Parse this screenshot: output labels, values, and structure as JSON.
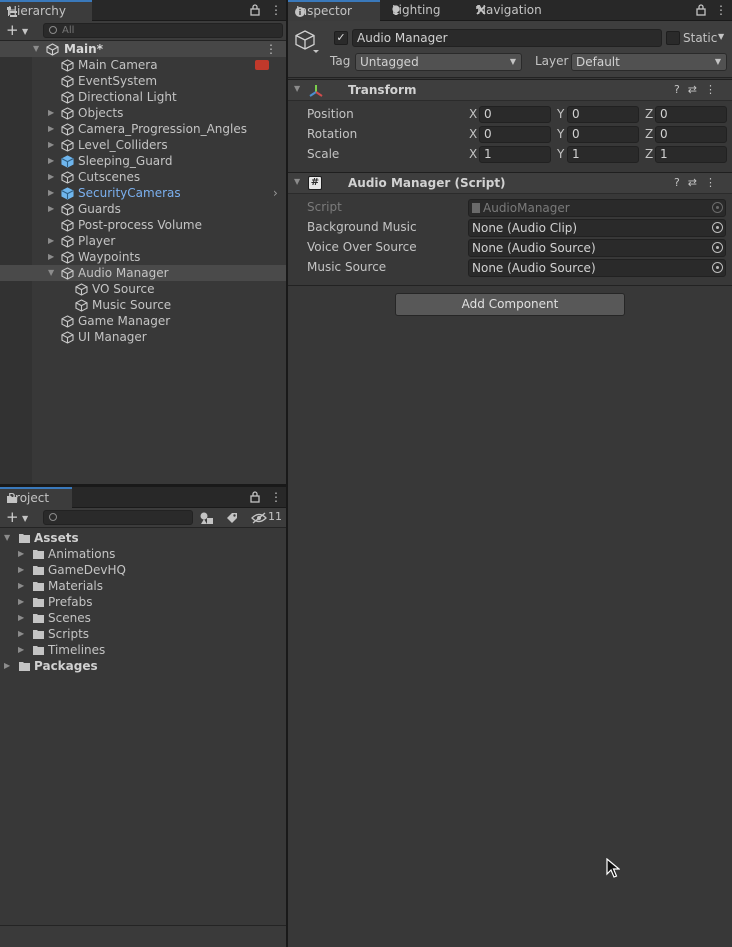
{
  "hierarchy": {
    "tab_label": "Hierarchy",
    "search_placeholder": "All",
    "scene_name": "Main*",
    "items": [
      {
        "label": "Main Camera",
        "indent": 1,
        "expandable": false,
        "prefab": false
      },
      {
        "label": "EventSystem",
        "indent": 1,
        "expandable": false,
        "prefab": false
      },
      {
        "label": "Directional Light",
        "indent": 1,
        "expandable": false,
        "prefab": false
      },
      {
        "label": "Objects",
        "indent": 1,
        "expandable": true,
        "expanded": false,
        "prefab": false
      },
      {
        "label": "Camera_Progression_Angles",
        "indent": 1,
        "expandable": true,
        "expanded": false,
        "prefab": false
      },
      {
        "label": "Level_Colliders",
        "indent": 1,
        "expandable": true,
        "expanded": false,
        "prefab": false
      },
      {
        "label": "Sleeping_Guard",
        "indent": 1,
        "expandable": true,
        "expanded": false,
        "prefab": true,
        "label_prefab_color": false
      },
      {
        "label": "Cutscenes",
        "indent": 1,
        "expandable": true,
        "expanded": false,
        "prefab": false
      },
      {
        "label": "SecurityCameras",
        "indent": 1,
        "expandable": true,
        "expanded": false,
        "prefab": true,
        "label_prefab_color": true
      },
      {
        "label": "Guards",
        "indent": 1,
        "expandable": true,
        "expanded": false,
        "prefab": false
      },
      {
        "label": "Post-process Volume",
        "indent": 1,
        "expandable": false,
        "prefab": false
      },
      {
        "label": "Player",
        "indent": 1,
        "expandable": true,
        "expanded": false,
        "prefab": false
      },
      {
        "label": "Waypoints",
        "indent": 1,
        "expandable": true,
        "expanded": false,
        "prefab": false
      },
      {
        "label": "Audio Manager",
        "indent": 1,
        "expandable": true,
        "expanded": true,
        "prefab": false,
        "selected": true
      },
      {
        "label": "VO Source",
        "indent": 2,
        "expandable": false,
        "prefab": false
      },
      {
        "label": "Music Source",
        "indent": 2,
        "expandable": false,
        "prefab": false
      },
      {
        "label": "Game Manager",
        "indent": 1,
        "expandable": false,
        "prefab": false
      },
      {
        "label": "UI Manager",
        "indent": 1,
        "expandable": false,
        "prefab": false
      }
    ]
  },
  "project": {
    "tab_label": "Project",
    "hidden_count": "11",
    "items": [
      {
        "label": "Assets",
        "indent": 0,
        "expanded": true,
        "bold": true
      },
      {
        "label": "Animations",
        "indent": 1,
        "expanded": false,
        "bold": false
      },
      {
        "label": "GameDevHQ",
        "indent": 1,
        "expanded": false,
        "bold": false
      },
      {
        "label": "Materials",
        "indent": 1,
        "expanded": false,
        "bold": false
      },
      {
        "label": "Prefabs",
        "indent": 1,
        "expanded": false,
        "bold": false
      },
      {
        "label": "Scenes",
        "indent": 1,
        "expanded": false,
        "bold": false
      },
      {
        "label": "Scripts",
        "indent": 1,
        "expanded": false,
        "bold": false
      },
      {
        "label": "Timelines",
        "indent": 1,
        "expanded": false,
        "bold": false
      },
      {
        "label": "Packages",
        "indent": 0,
        "expanded": false,
        "bold": true
      }
    ]
  },
  "inspector": {
    "tabs": [
      {
        "label": "Inspector",
        "icon": "info-icon"
      },
      {
        "label": "Lighting",
        "icon": "bulb-icon"
      },
      {
        "label": "Navigation",
        "icon": "compass-icon"
      }
    ],
    "object_name": "Audio Manager",
    "static_label": "Static",
    "tag_label": "Tag",
    "tag_value": "Untagged",
    "layer_label": "Layer",
    "layer_value": "Default",
    "transform": {
      "title": "Transform",
      "rows": [
        {
          "label": "Position",
          "x": "0",
          "y": "0",
          "z": "0"
        },
        {
          "label": "Rotation",
          "x": "0",
          "y": "0",
          "z": "0"
        },
        {
          "label": "Scale",
          "x": "1",
          "y": "1",
          "z": "1"
        }
      ]
    },
    "script_component": {
      "title": "Audio Manager (Script)",
      "rows": [
        {
          "label": "Script",
          "value": "AudioManager",
          "disabled": true
        },
        {
          "label": "Background Music",
          "value": "None (Audio Clip)",
          "disabled": false
        },
        {
          "label": "Voice Over Source",
          "value": "None (Audio Source)",
          "disabled": false
        },
        {
          "label": "Music Source",
          "value": "None (Audio Source)",
          "disabled": false
        }
      ]
    },
    "add_component_label": "Add Component"
  },
  "colors": {
    "accent": "#3a79bb",
    "prefab_text": "#7bb0ef",
    "panel": "#383838"
  }
}
